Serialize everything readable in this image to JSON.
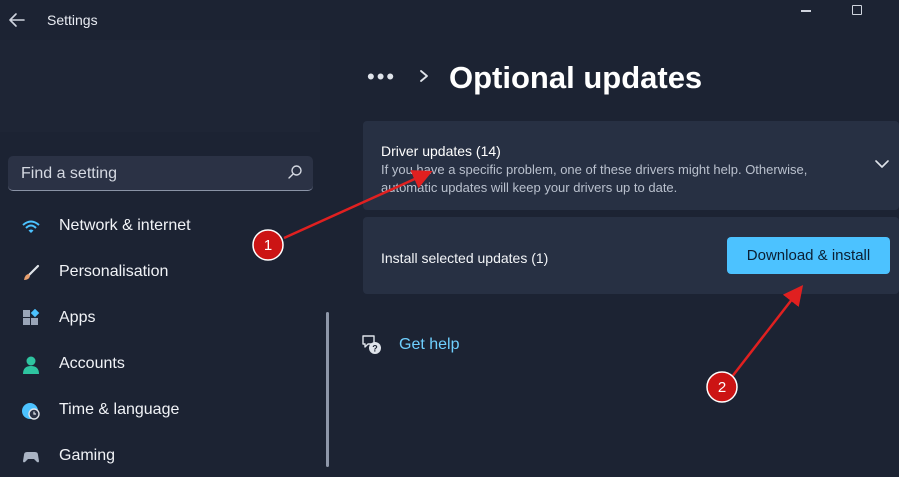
{
  "window": {
    "app_title": "Settings",
    "back_icon": "arrow-left-icon",
    "controls": [
      "minimize-icon",
      "maximize-icon"
    ]
  },
  "sidebar": {
    "search": {
      "placeholder": "Find a setting",
      "icon": "search-icon"
    },
    "items": [
      {
        "label": "Network & internet",
        "icon": "wifi-icon",
        "color": "#4cc2ff"
      },
      {
        "label": "Personalisation",
        "icon": "paintbrush-icon",
        "color": "#e8a070"
      },
      {
        "label": "Apps",
        "icon": "apps-icon",
        "color": "#9aa5b8"
      },
      {
        "label": "Accounts",
        "icon": "person-icon",
        "color": "#2ec4a0"
      },
      {
        "label": "Time & language",
        "icon": "globe-clock-icon",
        "color": "#4cc2ff"
      },
      {
        "label": "Gaming",
        "icon": "gamepad-icon",
        "color": "#aab4c4"
      }
    ]
  },
  "main": {
    "breadcrumb_more": "•••",
    "page_title": "Optional updates",
    "driver_updates": {
      "title": "Driver updates (14)",
      "description": "If you have a specific problem, one of these drivers might help. Otherwise, automatic updates will keep your drivers up to date.",
      "expand_icon": "chevron-down-icon"
    },
    "install": {
      "label": "Install selected updates (1)",
      "button_label": "Download & install"
    },
    "help": {
      "label": "Get help",
      "icon": "help-chat-icon"
    }
  },
  "annotations": [
    {
      "number": "1",
      "color": "#e02020"
    },
    {
      "number": "2",
      "color": "#e02020"
    }
  ],
  "colors": {
    "background": "#1c2333",
    "card": "#273043",
    "accent": "#4cc2ff",
    "annotation": "#e02020"
  }
}
